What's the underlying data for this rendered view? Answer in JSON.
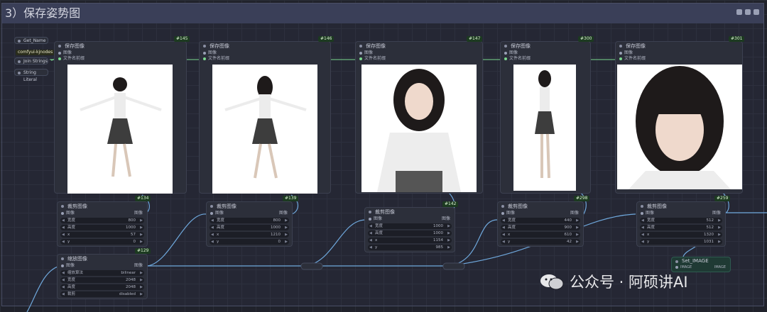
{
  "group": {
    "title": "3）保存姿势图"
  },
  "left_nodes": {
    "get_name": "Get_Name",
    "kjnodes_tag": "comfyui-kjnodes",
    "join": "Join Strings",
    "string_literal": "String Literal"
  },
  "save_nodes": [
    {
      "id": "#145",
      "title": "保存图像",
      "port_image": "图像",
      "port_filename": "文件名前缀"
    },
    {
      "id": "#146",
      "title": "保存图像",
      "port_image": "图像",
      "port_filename": "文件名前缀"
    },
    {
      "id": "#147",
      "title": "保存图像",
      "port_image": "图像",
      "port_filename": "文件名前缀"
    },
    {
      "id": "#300",
      "title": "保存图像",
      "port_image": "图像",
      "port_filename": "文件名前缀"
    },
    {
      "id": "#301",
      "title": "保存图像",
      "port_image": "图像",
      "port_filename": "文件名前缀"
    }
  ],
  "crop_nodes": [
    {
      "id": "#134",
      "title": "裁剪图像",
      "port_in": "图像",
      "port_out": "图像",
      "w_label": "宽度",
      "w": "800",
      "h_label": "高度",
      "h": "1000",
      "x_label": "x",
      "x": "57",
      "y_label": "y",
      "y": "0"
    },
    {
      "id": "#139",
      "title": "裁剪图像",
      "port_in": "图像",
      "port_out": "图像",
      "w_label": "宽度",
      "w": "800",
      "h_label": "高度",
      "h": "1000",
      "x_label": "x",
      "x": "1210",
      "y_label": "y",
      "y": "0"
    },
    {
      "id": "#142",
      "title": "裁剪图像",
      "port_in": "图像",
      "port_out": "图像",
      "w_label": "宽度",
      "w": "1000",
      "h_label": "高度",
      "h": "1000",
      "x_label": "x",
      "x": "1154",
      "y_label": "y",
      "y": "985"
    },
    {
      "id": "#298",
      "title": "裁剪图像",
      "port_in": "图像",
      "port_out": "图像",
      "w_label": "宽度",
      "w": "440",
      "h_label": "高度",
      "h": "900",
      "x_label": "x",
      "x": "610",
      "y_label": "y",
      "y": "42"
    },
    {
      "id": "#259",
      "title": "裁剪图像",
      "port_in": "图像",
      "port_out": "图像",
      "w_label": "宽度",
      "w": "512",
      "h_label": "高度",
      "h": "512",
      "x_label": "x",
      "x": "1320",
      "y_label": "y",
      "y": "1031"
    }
  ],
  "upscale_node": {
    "id": "#129",
    "title": "缩放图像",
    "port_in": "图像",
    "port_out": "图像",
    "method_label": "缩放算法",
    "method": "bilinear",
    "w_label": "宽度",
    "w": "2048",
    "h_label": "高度",
    "h": "2048",
    "crop_label": "裁剪",
    "crop": "disabled"
  },
  "set_node": {
    "title": "Set_IMAGE",
    "port_in": "IMAGE",
    "port_out": "IMAGE"
  },
  "watermark": {
    "text": "公众号 · 阿硕讲AI"
  },
  "colors": {
    "image_wire": "#6fa8dc",
    "string_wire": "#7bd88f",
    "badge_bg": "#1c3a20"
  }
}
